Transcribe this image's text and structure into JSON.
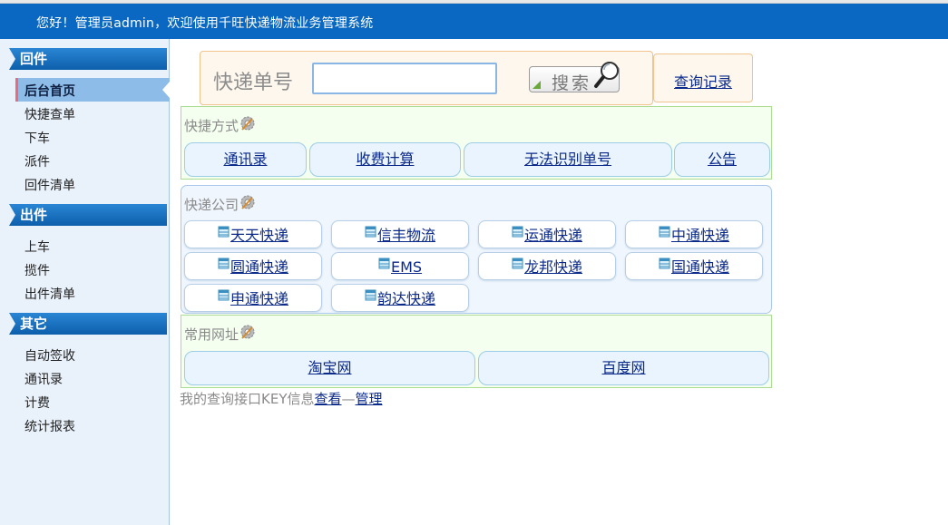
{
  "header": {
    "welcome": "您好！管理员admin，欢迎使用千旺快递物流业务管理系统"
  },
  "sidebar": {
    "sections": [
      {
        "title": "回件",
        "items": [
          "后台首页",
          "快捷查单",
          "下车",
          "派件",
          "回件清单"
        ]
      },
      {
        "title": "出件",
        "items": [
          "上车",
          "揽件",
          "出件清单"
        ]
      },
      {
        "title": "其它",
        "items": [
          "自动签收",
          "通讯录",
          "计费",
          "统计报表"
        ]
      }
    ],
    "active_item": "后台首页"
  },
  "search": {
    "label": "快递单号",
    "value": "",
    "button_label": "搜索",
    "history_link": "查询记录"
  },
  "shortcuts": {
    "title": "快捷方式",
    "items": [
      "通讯录",
      "收费计算",
      "无法识别单号",
      "公告"
    ]
  },
  "companies": {
    "title": "快递公司",
    "items": [
      "天天快递",
      "信丰物流",
      "运通快递",
      "中通快递",
      "圆通快递",
      "EMS",
      "龙邦快递",
      "国通快递",
      "申通快递",
      "韵达快递"
    ]
  },
  "sites": {
    "title": "常用网址",
    "items": [
      "淘宝网",
      "百度网"
    ]
  },
  "footer": {
    "text": "我的查询接口KEY信息",
    "view_link": "查看",
    "separator": "—",
    "manage_link": "管理"
  },
  "colors": {
    "header_bg": "#0a68c2",
    "sidebar_bg": "#e9f1fb",
    "link": "#0b2a8a",
    "section_head": "#0d5fab"
  },
  "icons": {
    "gear": "gear-icon",
    "magnifier": "magnifier-icon",
    "company": "database-icon"
  }
}
